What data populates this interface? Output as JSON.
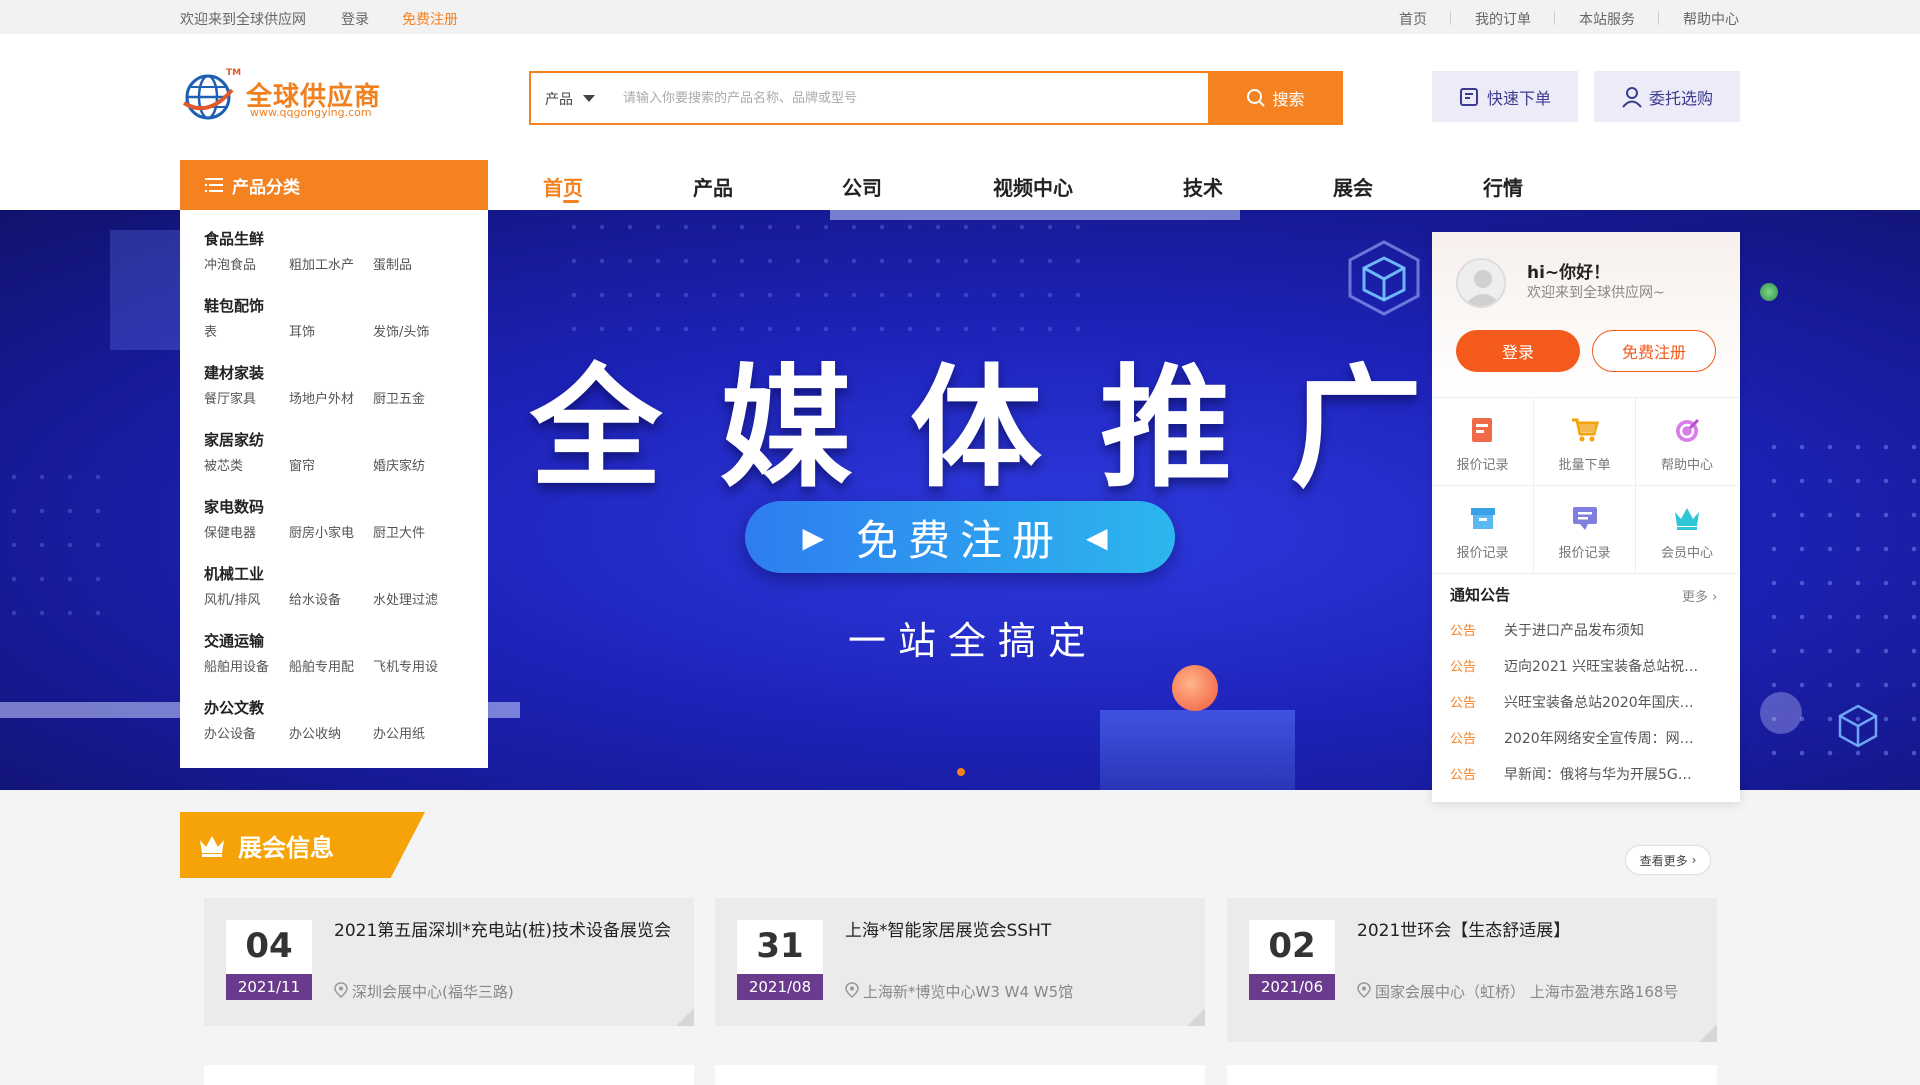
{
  "topbar": {
    "welcome": "欢迎来到全球供应网",
    "login": "登录",
    "register": "免费注册",
    "links": [
      "首页",
      "我的订单",
      "本站服务",
      "帮助中心"
    ]
  },
  "logo": {
    "name": "全球供应商",
    "url_text": "www.qqgongying.com",
    "tm": "TM"
  },
  "search": {
    "type": "产品",
    "placeholder": "请输入你要搜索的产品名称、品牌或型号",
    "button": "搜索"
  },
  "actions": {
    "quick_order": "快速下单",
    "entrust": "委托选购"
  },
  "nav": {
    "category_label": "产品分类",
    "items": [
      "首页",
      "产品",
      "公司",
      "视频中心",
      "技术",
      "展会",
      "行情"
    ],
    "active": "首页"
  },
  "categories": [
    {
      "title": "食品生鲜",
      "subs": [
        "冲泡食品",
        "粗加工水产",
        "蛋制品"
      ]
    },
    {
      "title": "鞋包配饰",
      "subs": [
        "表",
        "耳饰",
        "发饰/头饰"
      ]
    },
    {
      "title": "建材家装",
      "subs": [
        "餐厅家具",
        "场地户外材",
        "厨卫五金"
      ]
    },
    {
      "title": "家居家纺",
      "subs": [
        "被芯类",
        "窗帘",
        "婚庆家纺"
      ]
    },
    {
      "title": "家电数码",
      "subs": [
        "保健电器",
        "厨房小家电",
        "厨卫大件"
      ]
    },
    {
      "title": "机械工业",
      "subs": [
        "风机/排风",
        "给水设备",
        "水处理过滤"
      ]
    },
    {
      "title": "交通运输",
      "subs": [
        "船舶用设备",
        "船舶专用配",
        "飞机专用设"
      ]
    },
    {
      "title": "办公文教",
      "subs": [
        "办公设备",
        "办公收纳",
        "办公用纸"
      ]
    }
  ],
  "banner": {
    "title": "全媒体推广",
    "pill": "免费注册",
    "subtitle": "一站全搞定"
  },
  "user_panel": {
    "greeting": "hi~你好！",
    "welcome": "欢迎来到全球供应网~",
    "login": "登录",
    "register": "免费注册",
    "quick_links": [
      {
        "label": "报价记录",
        "icon": "document-icon"
      },
      {
        "label": "批量下单",
        "icon": "cart-icon"
      },
      {
        "label": "帮助中心",
        "icon": "help-icon"
      },
      {
        "label": "报价记录",
        "icon": "box-icon"
      },
      {
        "label": "报价记录",
        "icon": "chat-icon"
      },
      {
        "label": "会员中心",
        "icon": "crown-icon"
      }
    ],
    "notice_title": "通知公告",
    "notice_more": "更多",
    "notice_tag": "公告",
    "notices": [
      "关于进口产品发布须知",
      "迈向2021 兴旺宝装备总站祝…",
      "兴旺宝装备总站2020年国庆…",
      "2020年网络安全宣传周：网…",
      "早新闻：俄将与华为开展5G…"
    ]
  },
  "exhibitions": {
    "title": "展会信息",
    "view_more": "查看更多",
    "items": [
      {
        "day": "04",
        "ym": "2021/11",
        "title": "2021第五届深圳*充电站(桩)技术设备展览会",
        "location": "深圳会展中心(福华三路)"
      },
      {
        "day": "31",
        "ym": "2021/08",
        "title": "上海*智能家居展览会SSHT",
        "location": "上海新*博览中心W3 W4 W5馆"
      },
      {
        "day": "02",
        "ym": "2021/06",
        "title": "2021世环会【生态舒适展】",
        "location": "国家会展中心（虹桥） 上海市盈港东路168号"
      }
    ]
  },
  "colors": {
    "accent": "#f58220",
    "banner": "#1d22b8",
    "date_band": "#6a3b8c",
    "exh_head": "#f5a308"
  }
}
